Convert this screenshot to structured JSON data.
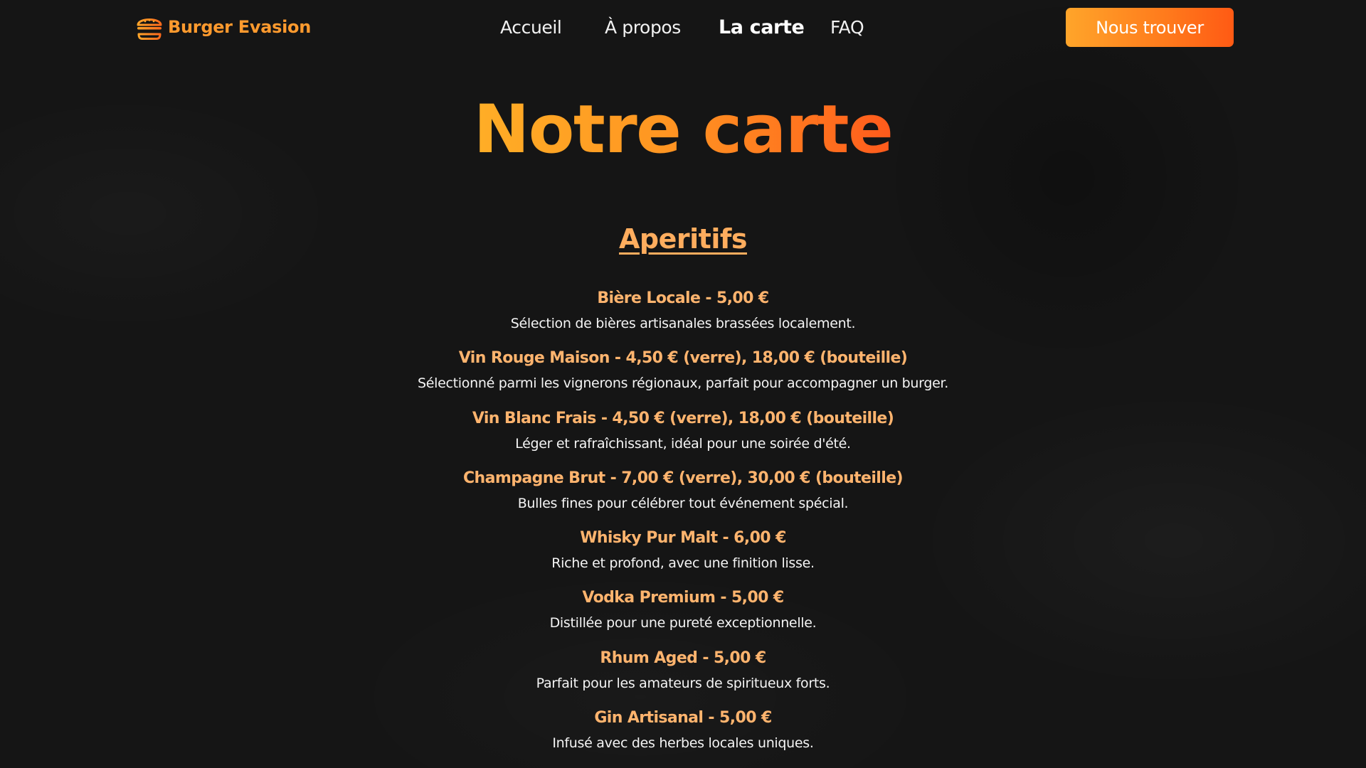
{
  "brand": {
    "name": "Burger Evasion",
    "icon": "burger-icon",
    "color": "#ff9a2e"
  },
  "nav": {
    "links": [
      {
        "label": "Accueil",
        "active": false
      },
      {
        "label": "À propos",
        "active": false
      },
      {
        "label": "La carte",
        "active": true
      },
      {
        "label": "FAQ",
        "active": false
      }
    ],
    "cta_label": "Nous trouver"
  },
  "page": {
    "title": "Notre carte",
    "accent_color": "#ff8a22",
    "background_color": "#151515"
  },
  "section": {
    "title": "Aperitifs",
    "items": [
      {
        "name": "Bière Locale - 5,00 €",
        "description": "Sélection de bières artisanales brassées localement."
      },
      {
        "name": "Vin Rouge Maison - 4,50 € (verre), 18,00 € (bouteille)",
        "description": "Sélectionné parmi les vignerons régionaux, parfait pour accompagner un burger."
      },
      {
        "name": "Vin Blanc Frais - 4,50 € (verre), 18,00 € (bouteille)",
        "description": "Léger et rafraîchissant, idéal pour une soirée d'été."
      },
      {
        "name": "Champagne Brut - 7,00 € (verre), 30,00 € (bouteille)",
        "description": "Bulles fines pour célébrer tout événement spécial."
      },
      {
        "name": "Whisky Pur Malt - 6,00 €",
        "description": "Riche et profond, avec une finition lisse."
      },
      {
        "name": "Vodka Premium - 5,00 €",
        "description": "Distillée pour une pureté exceptionnelle."
      },
      {
        "name": "Rhum Aged - 5,00 €",
        "description": "Parfait pour les amateurs de spiritueux forts."
      },
      {
        "name": "Gin Artisanal - 5,00 €",
        "description": "Infusé avec des herbes locales uniques."
      }
    ]
  }
}
